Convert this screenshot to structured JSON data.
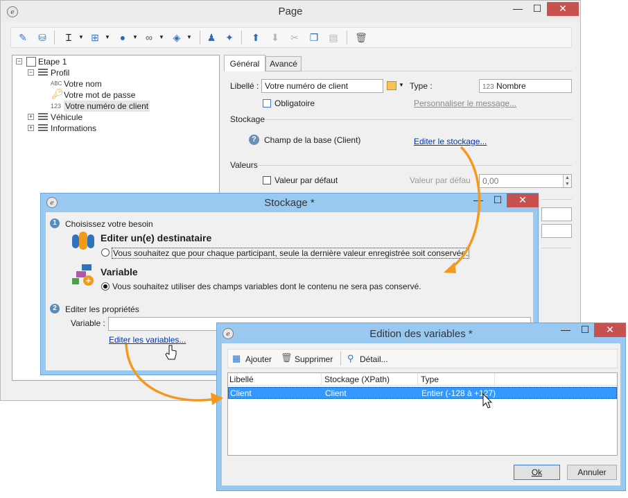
{
  "page_window": {
    "title": "Page",
    "tree": [
      {
        "label": "Etape 1"
      },
      {
        "label": "Profil"
      },
      {
        "label": "Votre nom",
        "badge": "ABC"
      },
      {
        "label": "Votre mot de passe"
      },
      {
        "label": "Votre numéro de client",
        "badge": "123"
      },
      {
        "label": "Véhicule"
      },
      {
        "label": "Informations"
      }
    ],
    "tabs": [
      "Général",
      "Avancé"
    ],
    "libelle_label": "Libellé :",
    "libelle_value": "Votre numéro de client",
    "type_label": "Type :",
    "type_badge": "123",
    "type_value": "Nombre",
    "obligatoire_label": "Obligatoire",
    "personnaliser_link": "Personnaliser le message...",
    "stockage_section": "Stockage",
    "champ_text": "Champ de la base (Client)",
    "editer_stockage_link": "Editer le stockage...",
    "valeurs_section": "Valeurs",
    "valeur_defaut_label": "Valeur par défaut",
    "valeur_defaut_field_label": "Valeur par défau",
    "valeur_defaut_value": "0,00"
  },
  "stockage_dialog": {
    "title": "Stockage *",
    "step1_num": "1",
    "step1_label": "Choisissez votre besoin",
    "option1_title": "Editer un(e) destinataire",
    "option1_text": "Vous souhaitez que pour chaque participant, seule la dernière valeur enregistrée soit conservée.",
    "option2_title": "Variable",
    "option2_text": "Vous souhaitez utiliser des champs variables dont le contenu ne sera pas conservé.",
    "step2_num": "2",
    "step2_label": "Editer les propriétés",
    "variable_label": "Variable :",
    "variable_value": "",
    "editer_variables_link": "Editer les variables..."
  },
  "variables_dialog": {
    "title": "Edition des variables *",
    "toolbar": {
      "add": "Ajouter",
      "delete": "Supprimer",
      "detail": "Détail..."
    },
    "columns": [
      "Libellé",
      "Stockage (XPath)",
      "Type"
    ],
    "rows": [
      {
        "libelle": "Client",
        "stockage": "Client",
        "type": "Entier (-128 à +127)"
      }
    ],
    "ok_label": "Ok",
    "cancel_label": "Annuler"
  },
  "colors": {
    "accent_blue": "#99c8f0",
    "selection": "#3399ff",
    "arrow_orange": "#f39a1c",
    "close_red": "#c7514e"
  }
}
